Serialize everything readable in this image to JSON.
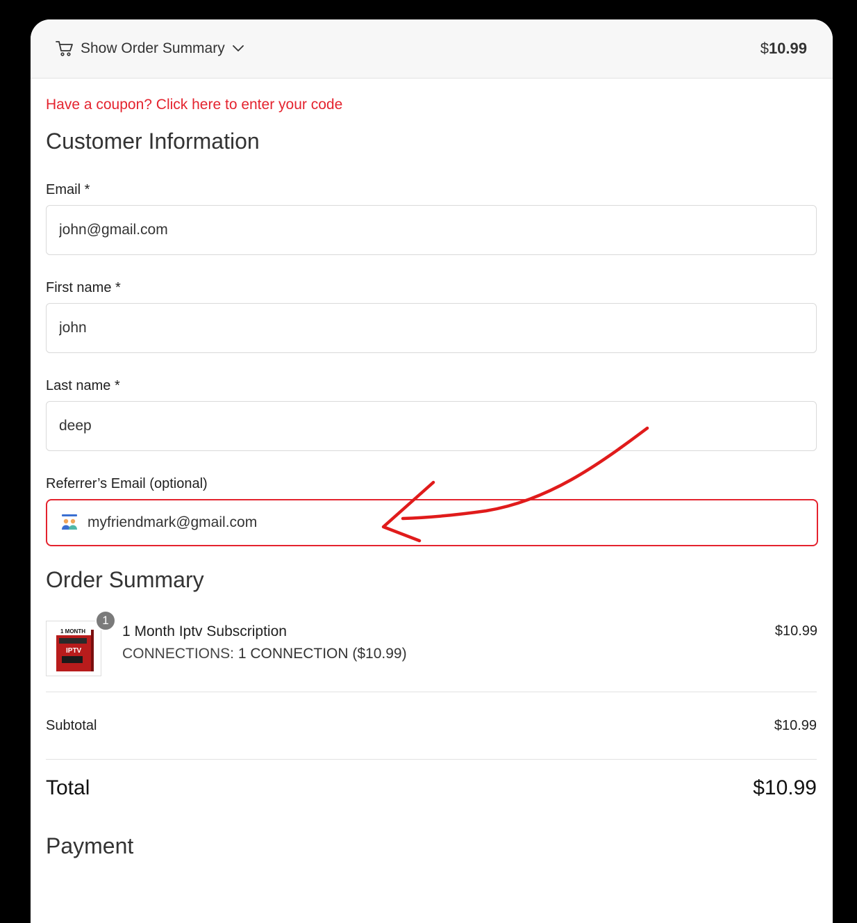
{
  "order_summary_bar": {
    "toggle_label": "Show Order Summary",
    "currency_symbol": "$",
    "amount": "10.99"
  },
  "coupon_link": "Have a coupon? Click here to enter your code",
  "customer_info": {
    "title": "Customer Information",
    "email_label": "Email *",
    "email_value": "john@gmail.com",
    "first_name_label": "First name *",
    "first_name_value": "john",
    "last_name_label": "Last name *",
    "last_name_value": "deep",
    "referrer_label": "Referrer’s Email (optional)",
    "referrer_value": "myfriendmark@gmail.com"
  },
  "order_summary": {
    "title": "Order Summary",
    "item": {
      "quantity": "1",
      "thumb_text_top": "1 MONTH",
      "thumb_text_mid": "IPTV",
      "name": "1 Month Iptv Subscription",
      "variant_label": "CONNECTIONS:",
      "variant_value": "1 CONNECTION ($10.99)",
      "price": "$10.99"
    },
    "subtotal_label": "Subtotal",
    "subtotal_value": "$10.99",
    "total_label": "Total",
    "total_value": "$10.99"
  },
  "payment": {
    "title": "Payment"
  },
  "colors": {
    "accent": "#e4232e",
    "background": "#000000"
  },
  "icons": [
    "cart-icon",
    "chevron-down-icon",
    "user-group-icon",
    "annotation-arrow"
  ]
}
